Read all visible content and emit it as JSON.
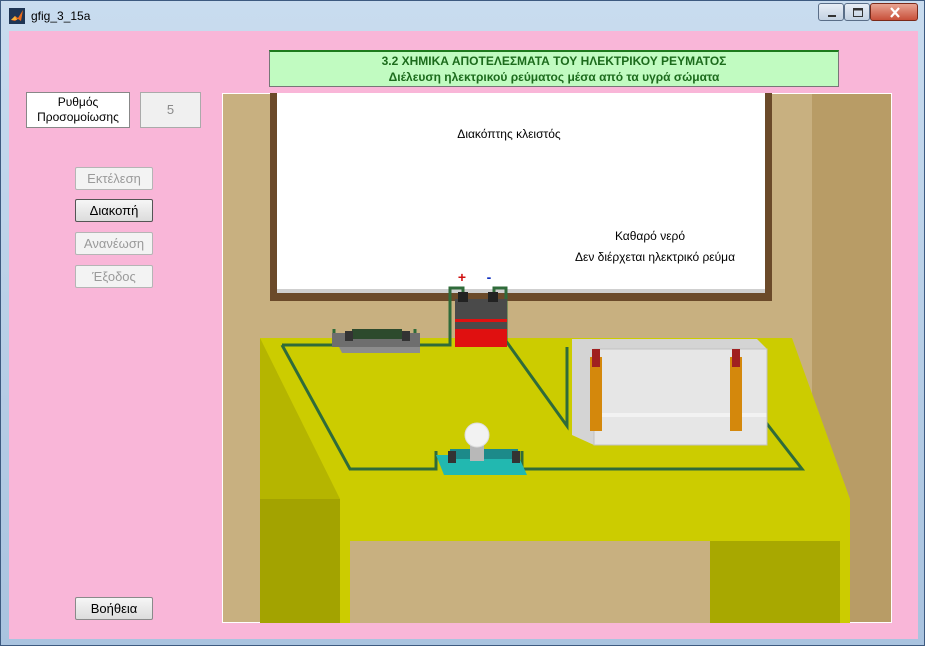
{
  "window": {
    "title": "gfig_3_15a"
  },
  "header": {
    "line1": "3.2 ΧΗΜΙΚΑ  ΑΠΟΤΕΛΕΣΜΑΤΑ ΤΟΥ ΗΛΕΚΤΡΙΚΟΥ ΡΕΥΜΑΤΟΣ",
    "line2": "Διέλευση ηλεκτρικού ρεύματος μέσα από τα υγρά σώματα"
  },
  "simulation": {
    "label_line1": "Ρυθμός",
    "label_line2": "Προσομοίωσης",
    "rate": "5"
  },
  "buttons": {
    "run": "Εκτέλεση",
    "stop": "Διακοπή",
    "refresh": "Ανανέωση",
    "exit": "Έξοδος",
    "help": "Βοήθεια"
  },
  "board": {
    "switch_status": "Διακόπτης κλειστός",
    "liquid": "Καθαρό νερό",
    "current_status": "Δεν διέρχεται ηλεκτρικό ρεύμα"
  },
  "battery": {
    "plus": "+",
    "minus": "-"
  },
  "colors": {
    "background": "#f9b6d8",
    "header_bg": "#c1fbc1",
    "header_text": "#1c6b1c",
    "table": "#cccc00",
    "wire": "#2f6b3a",
    "wall": "#c8b080"
  },
  "icons": {
    "app": "matlab-icon",
    "minimize": "minimize-icon",
    "maximize": "maximize-icon",
    "close": "close-icon"
  }
}
